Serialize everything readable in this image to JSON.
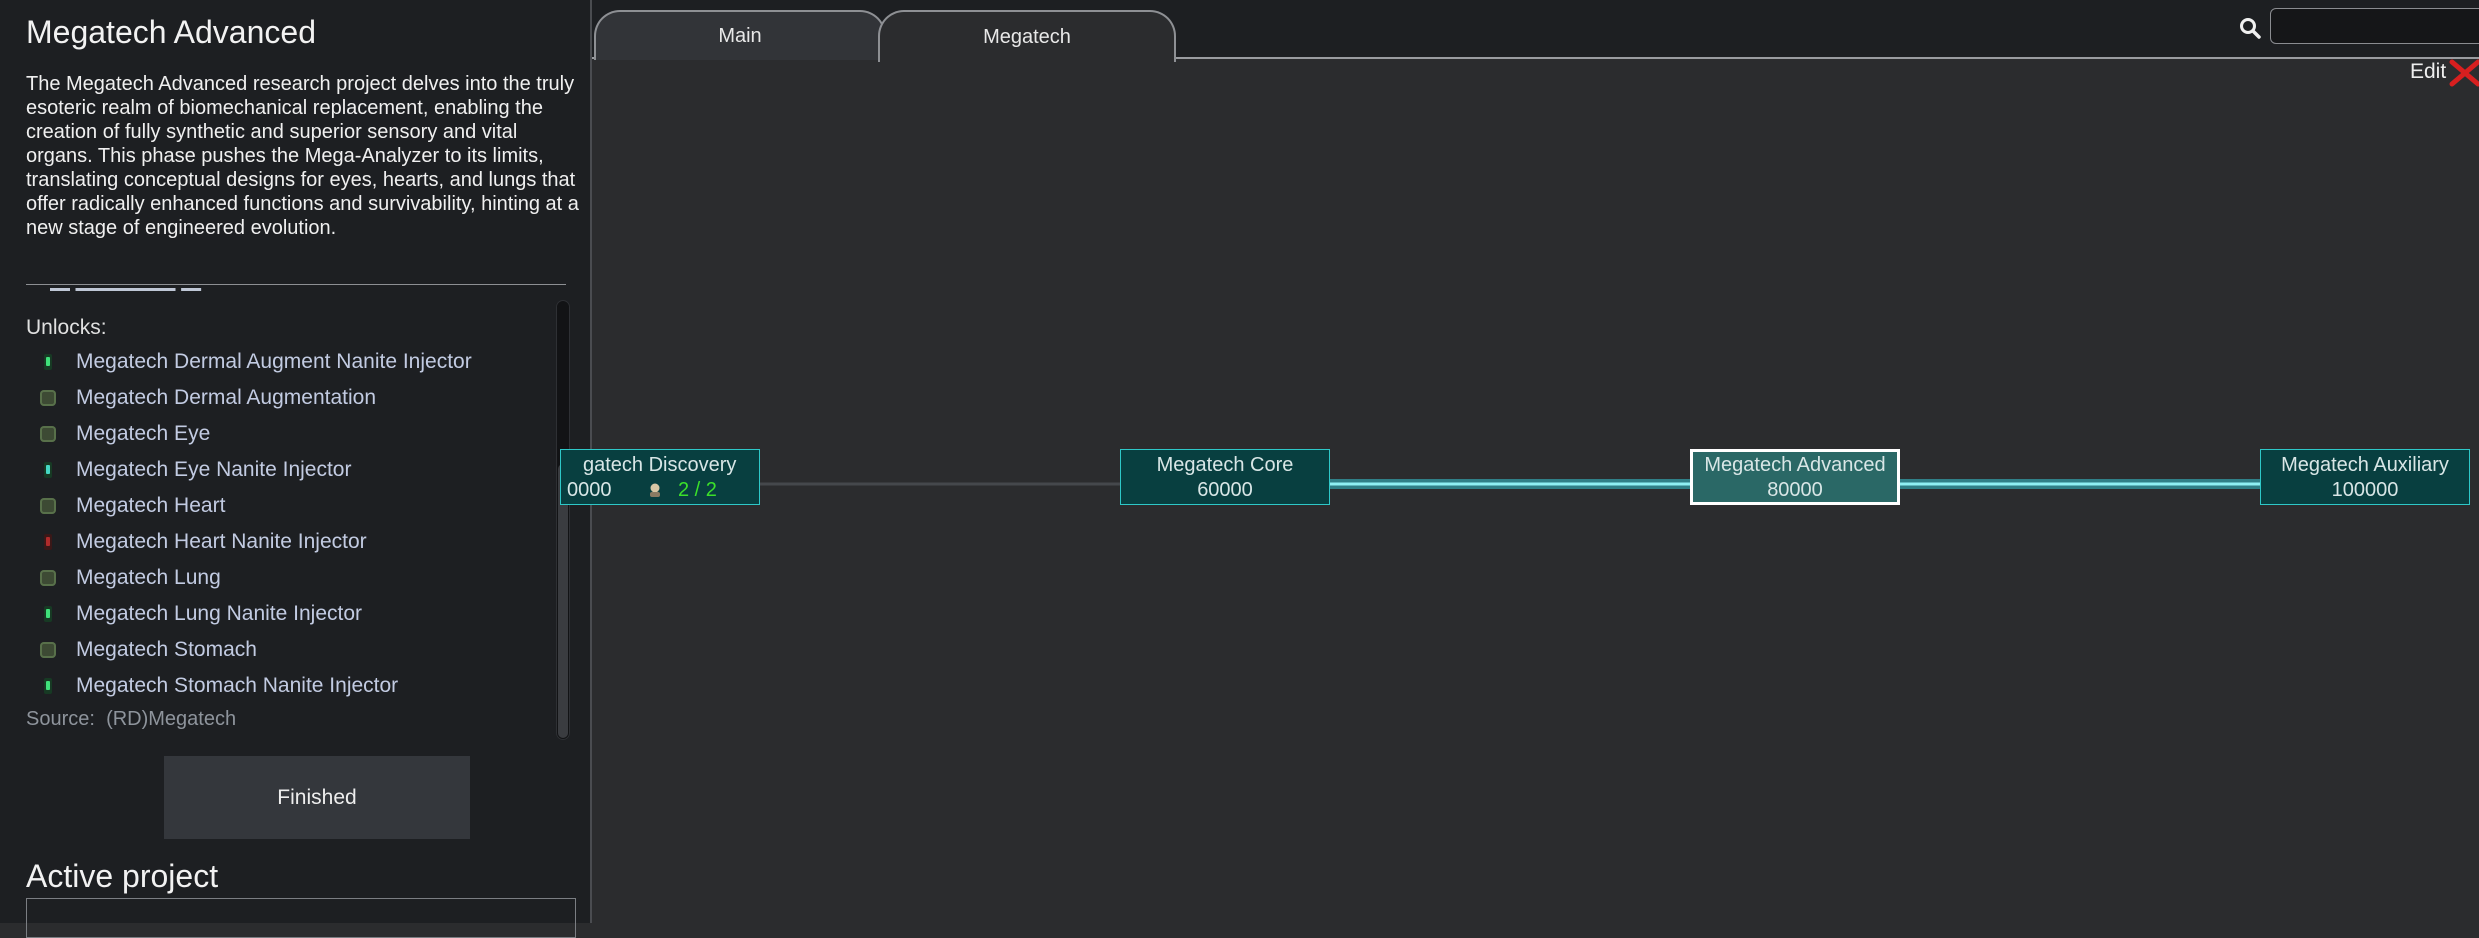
{
  "project": {
    "title": "Megatech Advanced",
    "description": "The Megatech Advanced research project delves into the truly esoteric realm of biomechanical replacement, enabling the creation of fully synthetic and superior sensory and vital organs. This phase pushes the Mega-Analyzer to its limits, translating conceptual designs for eyes, hearts, and lungs that offer radically enhanced functions and survivability, hinting at a new stage of engineered evolution.",
    "unlocks_heading": "Unlocks:",
    "unlocks": [
      {
        "label": "Megatech Dermal Augment Nanite Injector",
        "icon": "nanite-injector-green-icon"
      },
      {
        "label": "Megatech Dermal Augmentation",
        "icon": "implant-icon"
      },
      {
        "label": "Megatech Eye",
        "icon": "implant-icon"
      },
      {
        "label": "Megatech Eye Nanite Injector",
        "icon": "nanite-injector-teal-icon"
      },
      {
        "label": "Megatech Heart",
        "icon": "implant-icon"
      },
      {
        "label": "Megatech Heart Nanite Injector",
        "icon": "nanite-injector-red-icon"
      },
      {
        "label": "Megatech Lung",
        "icon": "implant-icon"
      },
      {
        "label": "Megatech Lung Nanite Injector",
        "icon": "nanite-injector-green-icon"
      },
      {
        "label": "Megatech Stomach",
        "icon": "implant-icon"
      },
      {
        "label": "Megatech Stomach Nanite Injector",
        "icon": "nanite-injector-green-icon"
      }
    ],
    "source_label": "Source:",
    "source_value": "(RD)Megatech",
    "status_button": "Finished",
    "active_heading": "Active project"
  },
  "tabs": [
    {
      "label": "Main",
      "selected": false
    },
    {
      "label": "Megatech",
      "selected": true
    }
  ],
  "toolbar": {
    "search_icon": "search-icon",
    "edit_label": "Edit",
    "close_icon": "close-x-icon"
  },
  "tree": {
    "nodes": [
      {
        "name": "Megatech Discovery",
        "name_shown": "gatech Discovery",
        "cost": "0000",
        "progress": "2 / 2",
        "icon": "colonist-icon"
      },
      {
        "name": "Megatech Core",
        "cost": "60000"
      },
      {
        "name": "Megatech Advanced",
        "cost": "80000",
        "selected": true
      },
      {
        "name": "Megatech Auxiliary",
        "cost": "100000"
      }
    ]
  },
  "colors": {
    "panel_bg": "#1d1f22",
    "canvas_bg": "#2b2c2e",
    "node_bg": "#083f40",
    "node_border": "#2ec8c8",
    "link_active": "#35c6d4",
    "progress_green": "#3be02a",
    "close_red": "#d81f1f"
  }
}
